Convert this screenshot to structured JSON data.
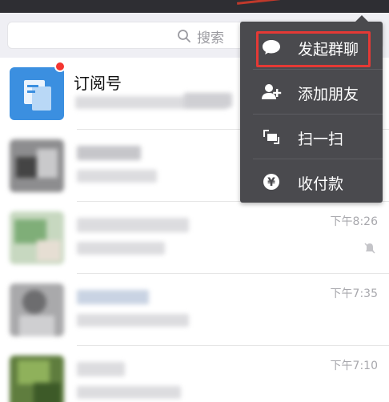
{
  "search": {
    "placeholder": "搜索"
  },
  "chats": [
    {
      "title": "订阅号",
      "time": ""
    },
    {
      "title": "",
      "time": ""
    },
    {
      "title": "",
      "time": "下午8:26"
    },
    {
      "title": "",
      "time": "下午7:35"
    },
    {
      "title": "",
      "time": "下午7:10"
    }
  ],
  "menu": {
    "items": [
      {
        "label": "发起群聊",
        "icon": "chat-bubble-icon"
      },
      {
        "label": "添加朋友",
        "icon": "add-friend-icon"
      },
      {
        "label": "扫一扫",
        "icon": "scan-icon"
      },
      {
        "label": "收付款",
        "icon": "yuan-icon"
      }
    ]
  },
  "colors": {
    "accent_red": "#e53935",
    "menu_bg": "#4a4a4e",
    "badge": "#f43530"
  }
}
